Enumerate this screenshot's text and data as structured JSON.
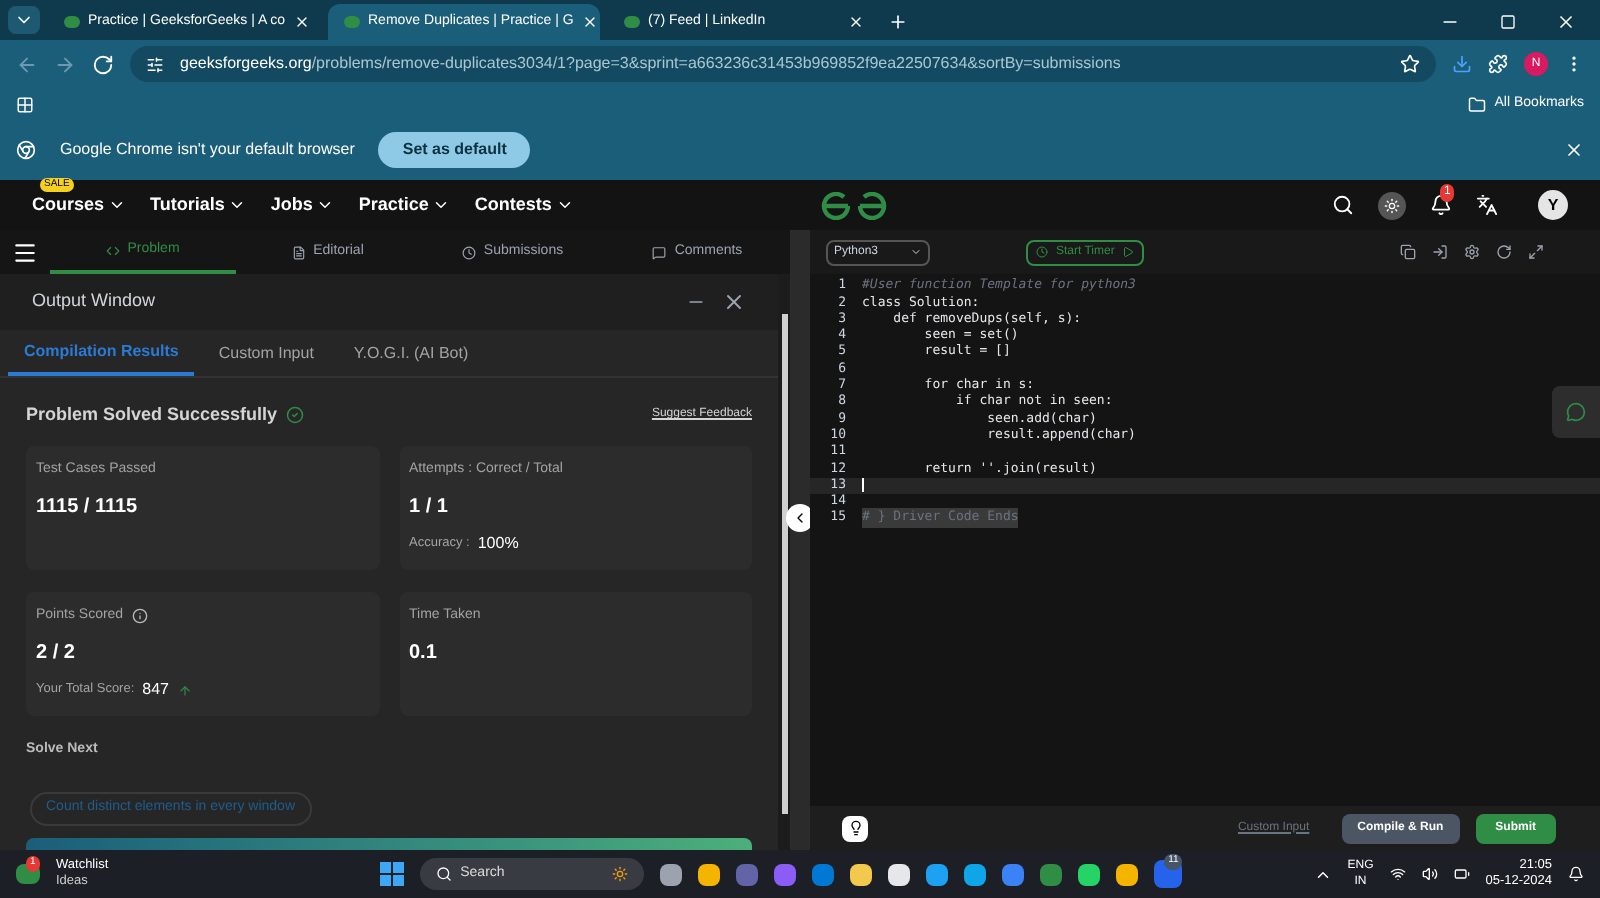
{
  "browser": {
    "tabs": [
      {
        "title": "Practice | GeeksforGeeks | A co",
        "selected": false
      },
      {
        "title": "Remove Duplicates | Practice | G",
        "selected": true
      },
      {
        "title": "(7) Feed | LinkedIn",
        "selected": false
      }
    ],
    "url": {
      "domain": "geeksforgeeks.org",
      "path": "/problems/remove-duplicates3034/1?page=3&sprint=a663236c31453b969852f9ea22507634&sortBy=submissions"
    },
    "profile": "N",
    "bookmarks": "All Bookmarks",
    "infobar": {
      "message": "Google Chrome isn't your default browser",
      "button": "Set as default"
    }
  },
  "site_nav": {
    "items": [
      {
        "label": "Courses",
        "badge": "SALE"
      },
      {
        "label": "Tutorials"
      },
      {
        "label": "Jobs"
      },
      {
        "label": "Practice"
      },
      {
        "label": "Contests"
      }
    ],
    "notifications": "1",
    "avatar": "Y"
  },
  "problem_tabs": [
    {
      "label": "Problem",
      "selected": true
    },
    {
      "label": "Editorial",
      "selected": false
    },
    {
      "label": "Submissions",
      "selected": false
    },
    {
      "label": "Comments",
      "selected": false
    }
  ],
  "output_window": {
    "title": "Output Window",
    "tabs": [
      {
        "label": "Compilation Results",
        "selected": true
      },
      {
        "label": "Custom Input",
        "selected": false
      },
      {
        "label": "Y.O.G.I. (AI Bot)",
        "selected": false
      }
    ],
    "status": "Problem Solved Successfully",
    "feedback": "Suggest Feedback",
    "cards": [
      {
        "label": "Test Cases Passed",
        "value": "1115 / 1115"
      },
      {
        "label": "Attempts : Correct / Total",
        "value": "1 / 1",
        "sub_label": "Accuracy :",
        "sub_value": "100%"
      },
      {
        "label": "Points Scored",
        "value": "2 / 2",
        "sub_label": "Your Total Score:",
        "sub_value": "847",
        "info": true,
        "trend": true
      },
      {
        "label": "Time Taken",
        "value": "0.1"
      }
    ],
    "solve_next": "Solve Next",
    "suggestion": "Count distinct elements in every window"
  },
  "editor": {
    "language": "Python3",
    "timer": "Start Timer",
    "lines": [
      {
        "number": "1",
        "text": "#User function Template for python3",
        "kind": "comment",
        "current": false
      },
      {
        "number": "2",
        "text": "class Solution:",
        "kind": "code",
        "current": false
      },
      {
        "number": "3",
        "text": "    def removeDups(self, s):",
        "kind": "code",
        "current": false
      },
      {
        "number": "4",
        "text": "        seen = set()",
        "kind": "code",
        "current": false
      },
      {
        "number": "5",
        "text": "        result = []",
        "kind": "code",
        "current": false
      },
      {
        "number": "6",
        "current": false
      },
      {
        "number": "7",
        "text": "        for char in s:",
        "kind": "code",
        "current": false
      },
      {
        "number": "8",
        "text": "            if char not in seen:",
        "kind": "code",
        "current": false
      },
      {
        "number": "9",
        "text": "                seen.add(char)",
        "kind": "code",
        "current": false
      },
      {
        "number": "10",
        "text": "                result.append(char)",
        "kind": "code",
        "current": false
      },
      {
        "number": "11",
        "current": false
      },
      {
        "number": "12",
        "text": "        return ''.join(result)",
        "kind": "code",
        "current": false
      },
      {
        "number": "13",
        "current": true
      },
      {
        "number": "14",
        "current": false
      },
      {
        "number": "15",
        "text": "# } Driver Code Ends",
        "kind": "folded",
        "current": false
      }
    ],
    "custom_input": "Custom Input",
    "compile": "Compile & Run",
    "submit": "Submit"
  },
  "taskbar": {
    "widget": {
      "title": "Watchlist",
      "subtitle": "Ideas",
      "badge": "1"
    },
    "search": "Search",
    "app_badge": "11",
    "language": "ENG",
    "region": "IN",
    "time": "21:05",
    "date": "05-12-2024"
  }
}
